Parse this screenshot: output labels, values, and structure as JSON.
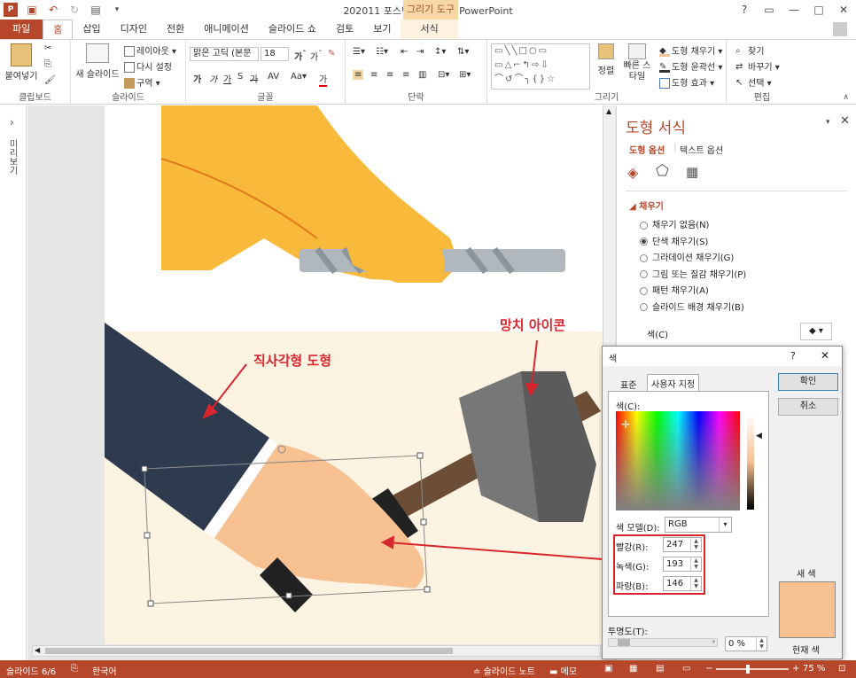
{
  "window": {
    "title": "202011 포스팅용 완성본 - PowerPoint",
    "context_group": "그리기 도구",
    "controls": [
      "?",
      "▭",
      "—",
      "□",
      "✕"
    ]
  },
  "tabs": [
    "파일",
    "홈",
    "삽입",
    "디자인",
    "전환",
    "애니메이션",
    "슬라이드 쇼",
    "검토",
    "보기",
    "서식"
  ],
  "ribbon": {
    "clipboard": {
      "paste": "붙여넣기",
      "label": "클립보드"
    },
    "slides": {
      "new_slide": "새 슬라이드",
      "layout": "레이아웃",
      "reset": "다시 설정",
      "section": "구역",
      "label": "슬라이드"
    },
    "font": {
      "name": "맑은 고딕 (본문",
      "size": "18",
      "label": "글꼴"
    },
    "paragraph": {
      "label": "단락"
    },
    "drawing": {
      "arrange": "정렬",
      "quick_styles": "빠른 스타일",
      "fill": "도형 채우기",
      "outline": "도형 윤곽선",
      "effects": "도형 효과",
      "label": "그리기"
    },
    "editing": {
      "find": "찾기",
      "replace": "바꾸기",
      "select": "선택",
      "label": "편집"
    }
  },
  "leftpane": {
    "label": "미리보기"
  },
  "annotations": {
    "rect": "직사각형 도형",
    "hammer": "망치 아이콘"
  },
  "taskpane": {
    "title": "도형 서식",
    "tab_shape": "도형 옵션",
    "tab_text": "텍스트 옵션",
    "section": "채우기",
    "options": [
      "채우기 없음(N)",
      "단색 채우기(S)",
      "그라데이션 채우기(G)",
      "그림 또는 질감 채우기(P)",
      "패턴 채우기(A)",
      "슬라이드 배경 채우기(B)"
    ],
    "selected_index": 1,
    "color_label": "색(C)"
  },
  "color_dialog": {
    "title": "색",
    "tab_standard": "표준",
    "tab_custom": "사용자 지정",
    "ok": "확인",
    "cancel": "취소",
    "colors_label": "색(C):",
    "model_label": "색 모델(D):",
    "model_value": "RGB",
    "red_label": "빨강(R):",
    "green_label": "녹색(G):",
    "blue_label": "파랑(B):",
    "red": "247",
    "green": "193",
    "blue": "146",
    "new_label": "새 색",
    "current_label": "현재 색",
    "transparency_label": "투명도(T):",
    "transparency_value": "0 %",
    "new_color": "#f7c192"
  },
  "statusbar": {
    "slide": "슬라이드 6/6",
    "lang": "한국어",
    "notes": "슬라이드 노트",
    "comments": "메모",
    "zoom": "75 %"
  },
  "colors": {
    "accent": "#b7472a",
    "annotation": "#d8262e"
  }
}
